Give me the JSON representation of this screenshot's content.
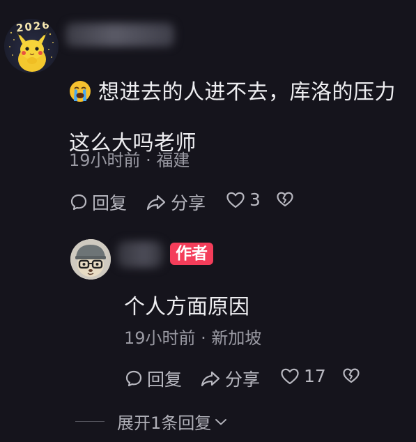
{
  "comment": {
    "text": "想进去的人进不去，库洛的压力这么大吗老师",
    "meta": "19小时前 · 福建",
    "avatar_year": "2026",
    "actions": {
      "reply_label": "回复",
      "share_label": "分享",
      "like_count": "3"
    }
  },
  "reply": {
    "author_badge": "作者",
    "text": "个人方面原因",
    "meta": "19小时前 · 新加坡",
    "actions": {
      "reply_label": "回复",
      "share_label": "分享",
      "like_count": "17"
    }
  },
  "expand": {
    "label": "展开1条回复"
  },
  "icons": {
    "emoji": "loudly-crying-face-emoji",
    "reply": "speech-bubble-icon",
    "share": "share-arrow-icon",
    "like": "heart-outline-icon",
    "dislike": "broken-heart-icon",
    "expand": "chevron-down-icon"
  },
  "colors": {
    "background": "#15141c",
    "text": "#eeeef1",
    "meta": "#9a9aa3",
    "author_badge": "#f43d5a"
  }
}
